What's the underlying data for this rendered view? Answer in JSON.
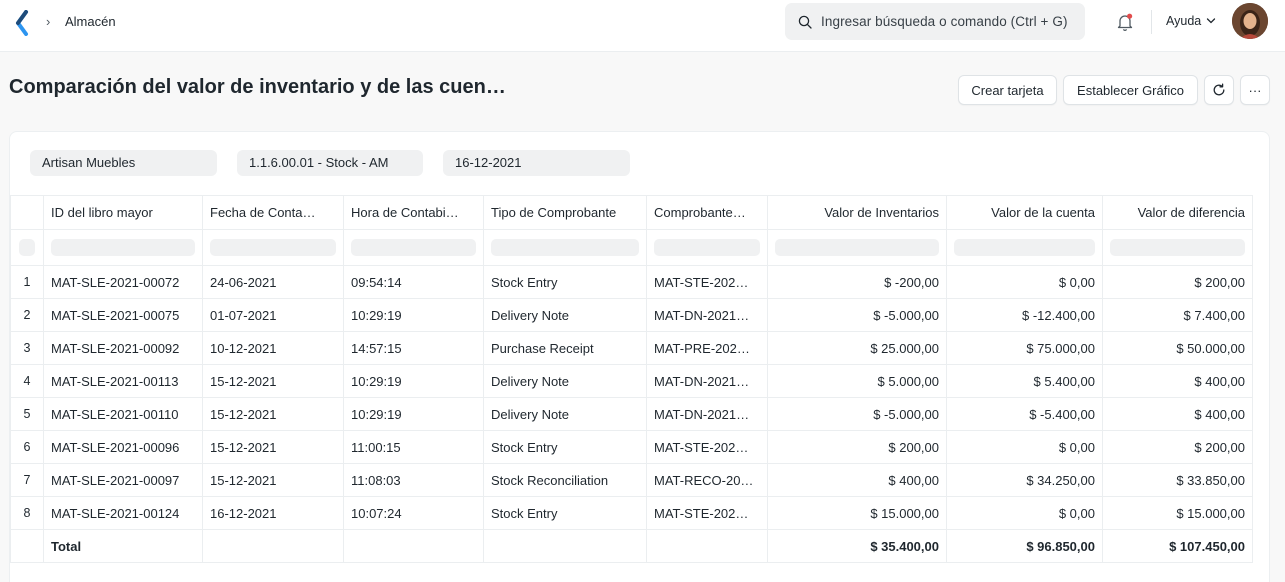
{
  "navbar": {
    "breadcrumb_sep": "›",
    "breadcrumb": "Almacén",
    "search_placeholder": "Ingresar búsqueda o comando (Ctrl + G)",
    "help_label": "Ayuda"
  },
  "page": {
    "title": "Comparación del valor de inventario y de las cuen…",
    "buttons": {
      "create_card": "Crear tarjeta",
      "set_chart": "Establecer Gráfico",
      "more": "···"
    }
  },
  "filters": {
    "company": "Artisan Muebles",
    "account": "1.1.6.00.01 - Stock - AM",
    "date": "16-12-2021"
  },
  "table": {
    "columns": [
      "ID del libro mayor",
      "Fecha de Conta…",
      "Hora de Contabi…",
      "Tipo de Comprobante",
      "Comprobante…",
      "Valor de Inventarios",
      "Valor de la cuenta",
      "Valor de diferencia"
    ],
    "rows": [
      {
        "idx": "1",
        "ledger": "MAT-SLE-2021-00072",
        "date": "24-06-2021",
        "time": "09:54:14",
        "type": "Stock Entry",
        "voucher": "MAT-STE-202…",
        "stock": "$ -200,00",
        "account": "$ 0,00",
        "diff": "$ 200,00"
      },
      {
        "idx": "2",
        "ledger": "MAT-SLE-2021-00075",
        "date": "01-07-2021",
        "time": "10:29:19",
        "type": "Delivery Note",
        "voucher": "MAT-DN-2021…",
        "stock": "$ -5.000,00",
        "account": "$ -12.400,00",
        "diff": "$ 7.400,00"
      },
      {
        "idx": "3",
        "ledger": "MAT-SLE-2021-00092",
        "date": "10-12-2021",
        "time": "14:57:15",
        "type": "Purchase Receipt",
        "voucher": "MAT-PRE-202…",
        "stock": "$ 25.000,00",
        "account": "$ 75.000,00",
        "diff": "$ 50.000,00"
      },
      {
        "idx": "4",
        "ledger": "MAT-SLE-2021-00113",
        "date": "15-12-2021",
        "time": "10:29:19",
        "type": "Delivery Note",
        "voucher": "MAT-DN-2021…",
        "stock": "$ 5.000,00",
        "account": "$ 5.400,00",
        "diff": "$ 400,00"
      },
      {
        "idx": "5",
        "ledger": "MAT-SLE-2021-00110",
        "date": "15-12-2021",
        "time": "10:29:19",
        "type": "Delivery Note",
        "voucher": "MAT-DN-2021…",
        "stock": "$ -5.000,00",
        "account": "$ -5.400,00",
        "diff": "$ 400,00"
      },
      {
        "idx": "6",
        "ledger": "MAT-SLE-2021-00096",
        "date": "15-12-2021",
        "time": "11:00:15",
        "type": "Stock Entry",
        "voucher": "MAT-STE-202…",
        "stock": "$ 200,00",
        "account": "$ 0,00",
        "diff": "$ 200,00"
      },
      {
        "idx": "7",
        "ledger": "MAT-SLE-2021-00097",
        "date": "15-12-2021",
        "time": "11:08:03",
        "type": "Stock Reconciliation",
        "voucher": "MAT-RECO-20…",
        "stock": "$ 400,00",
        "account": "$ 34.250,00",
        "diff": "$ 33.850,00"
      },
      {
        "idx": "8",
        "ledger": "MAT-SLE-2021-00124",
        "date": "16-12-2021",
        "time": "10:07:24",
        "type": "Stock Entry",
        "voucher": "MAT-STE-202…",
        "stock": "$ 15.000,00",
        "account": "$ 0,00",
        "diff": "$ 15.000,00"
      }
    ],
    "total": {
      "label": "Total",
      "stock": "$ 35.400,00",
      "account": "$ 96.850,00",
      "diff": "$ 107.450,00"
    }
  }
}
